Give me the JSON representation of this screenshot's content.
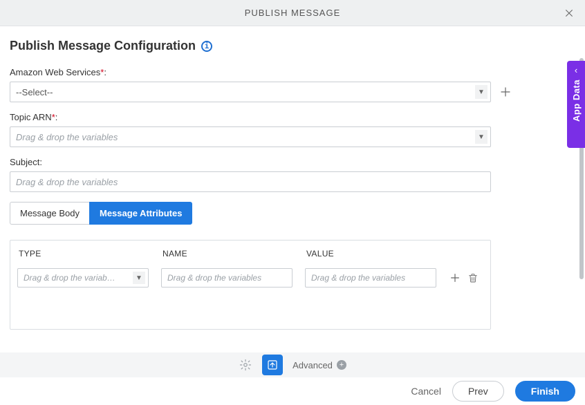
{
  "header": {
    "title": "PUBLISH MESSAGE"
  },
  "page": {
    "title": "Publish Message Configuration"
  },
  "sidepanel": {
    "label": "App Data"
  },
  "fields": {
    "aws": {
      "label": "Amazon Web Services",
      "value": "--Select--"
    },
    "topic_arn": {
      "label": "Topic ARN",
      "placeholder": "Drag & drop the variables"
    },
    "subject": {
      "label": "Subject:",
      "placeholder": "Drag & drop the variables"
    }
  },
  "tabs": {
    "body_label": "Message Body",
    "attrs_label": "Message Attributes"
  },
  "attr_table": {
    "head_type": "TYPE",
    "head_name": "NAME",
    "head_value": "VALUE",
    "type_placeholder": "Drag & drop the variab…",
    "name_placeholder": "Drag & drop the variables",
    "value_placeholder": "Drag & drop the variables"
  },
  "toolbar": {
    "advanced_label": "Advanced"
  },
  "footer": {
    "cancel": "Cancel",
    "prev": "Prev",
    "finish": "Finish"
  }
}
